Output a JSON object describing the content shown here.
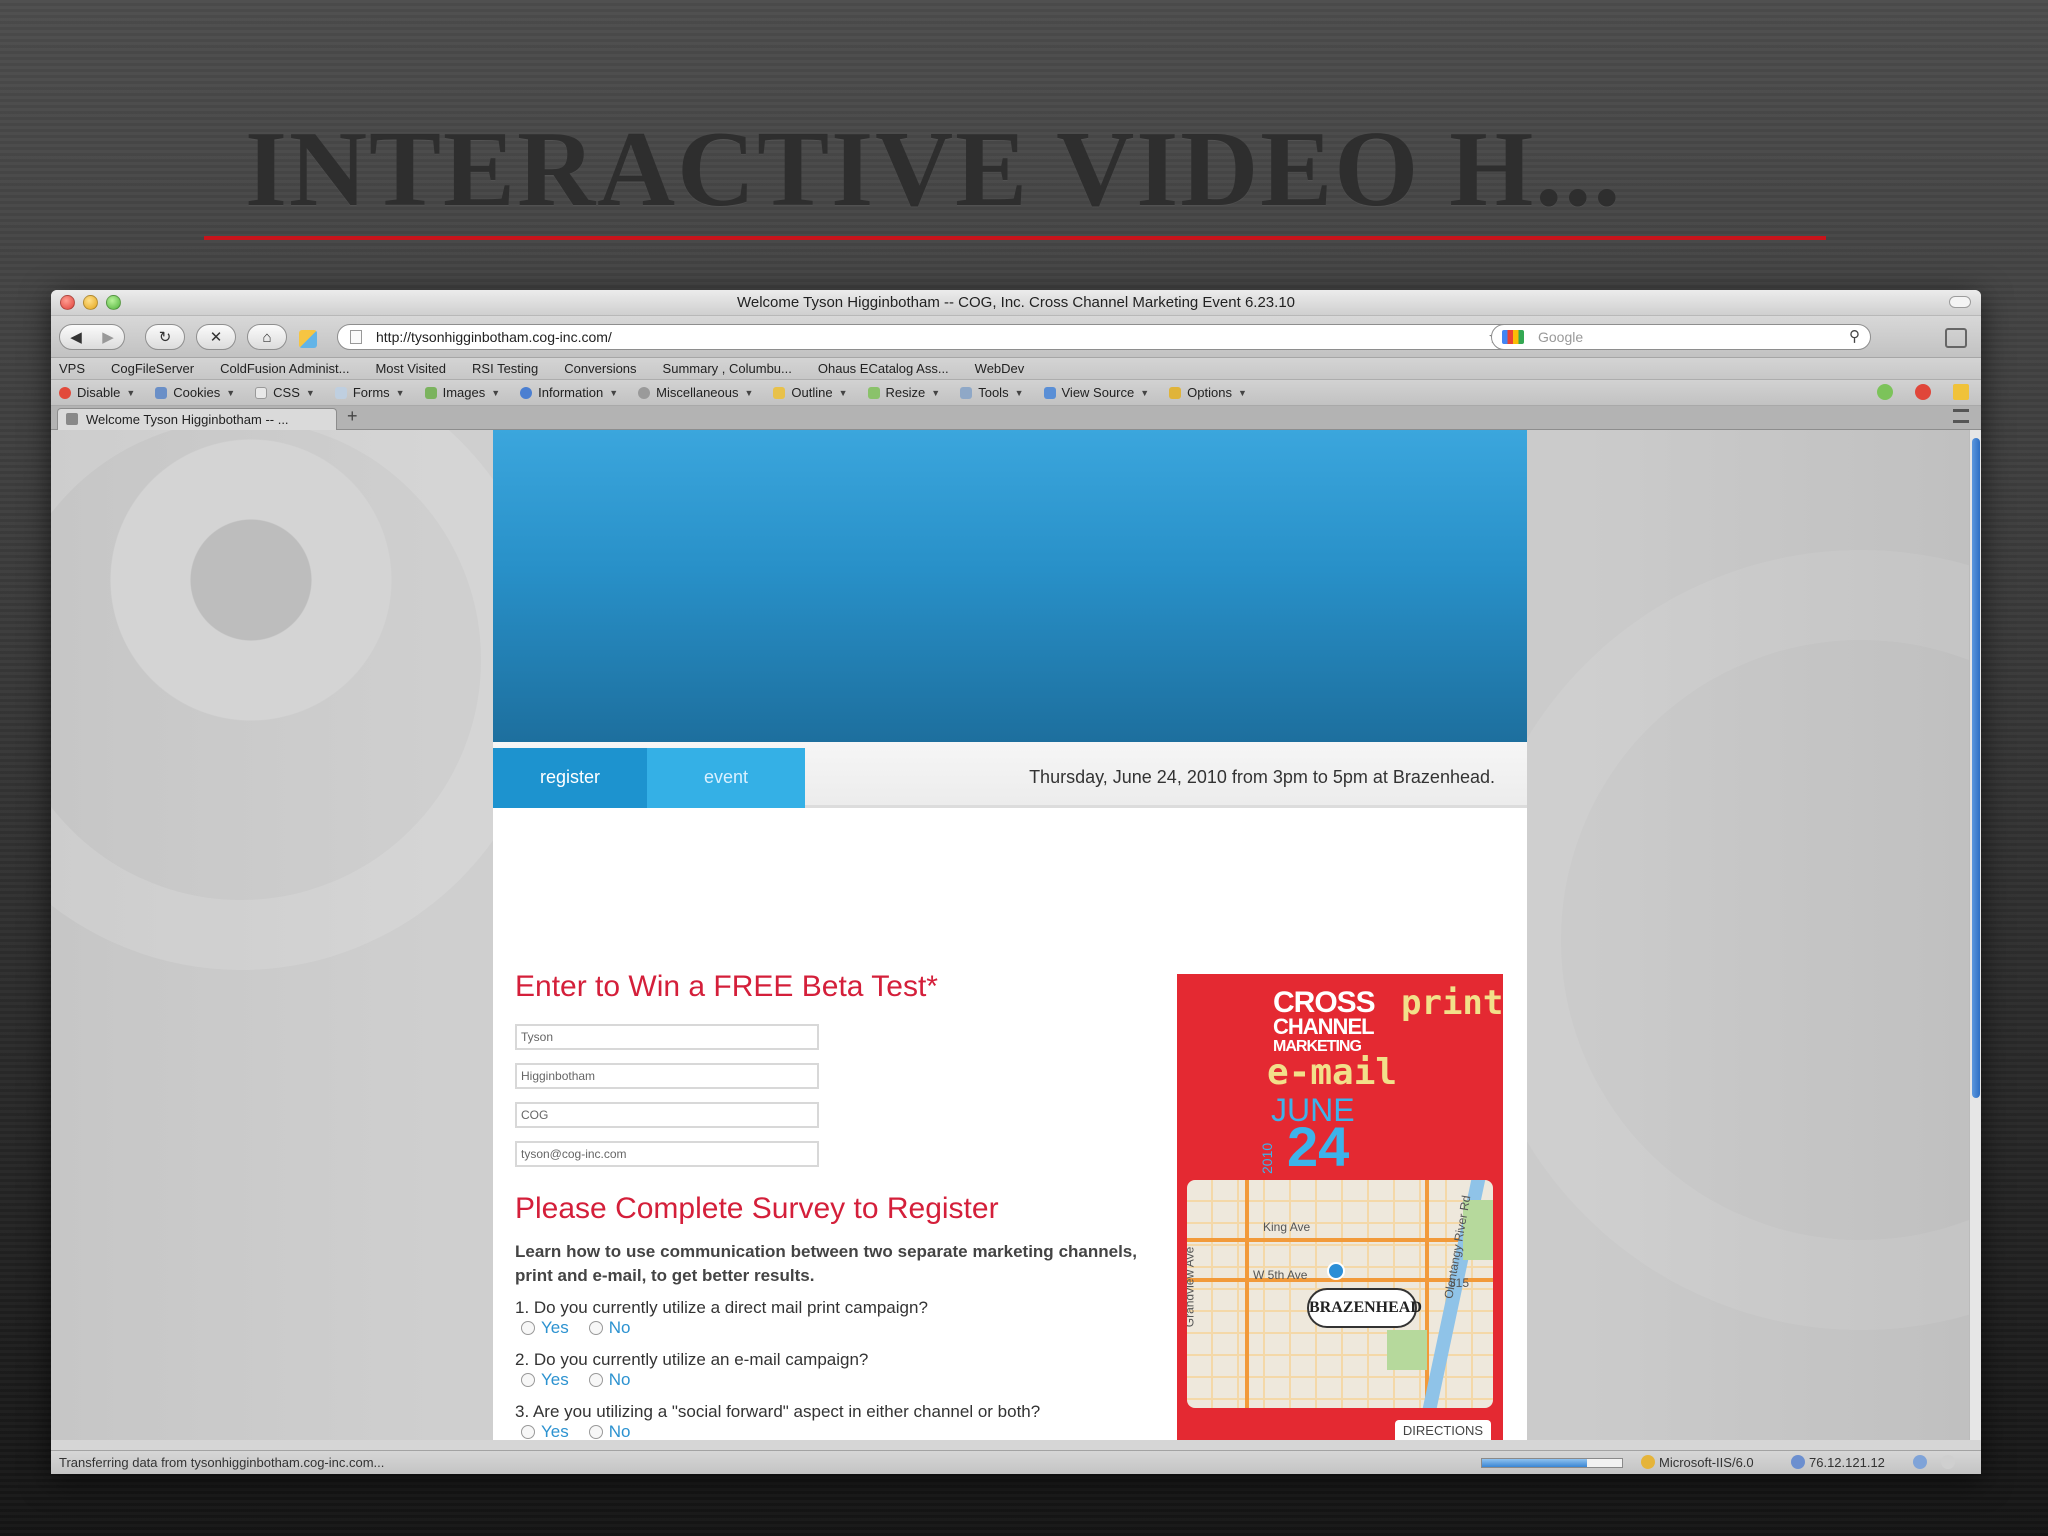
{
  "slide": {
    "title": "INTERACTIVE VIDEO H...",
    "accent_color": "#c8141b"
  },
  "browser": {
    "window_title": "Welcome Tyson Higginbotham -- COG, Inc. Cross Channel Marketing Event 6.23.10",
    "url": "http://tysonhigginbotham.cog-inc.com/",
    "search_placeholder": "Google",
    "bookmarks": [
      "VPS",
      "CogFileServer",
      "ColdFusion Administ...",
      "Most Visited",
      "RSI Testing",
      "Conversions",
      "Summary , Columbu...",
      "Ohaus ECatalog Ass...",
      "WebDev"
    ],
    "devtools": [
      "Disable",
      "Cookies",
      "CSS",
      "Forms",
      "Images",
      "Information",
      "Miscellaneous",
      "Outline",
      "Resize",
      "Tools",
      "View Source",
      "Options"
    ],
    "tab_title": "Welcome Tyson Higginbotham -- ...",
    "new_tab_symbol": "+",
    "status_text": "Transferring data from tysonhigginbotham.cog-inc.com...",
    "server": "Microsoft-IIS/6.0",
    "ip": "76.12.121.12",
    "load_progress": 0.75
  },
  "page": {
    "nav_register": "register",
    "nav_event": "event",
    "event_date": "Thursday, June 24, 2010 from 3pm to 5pm at Brazenhead.",
    "form_heading": "Enter to Win a FREE Beta Test*",
    "inputs": {
      "first_name": "Tyson",
      "last_name": "Higginbotham",
      "company": "COG",
      "email": "tyson@cog-inc.com"
    },
    "survey_heading": "Please Complete Survey to Register",
    "survey_intro": "Learn how to use communication between two separate marketing channels, print and e-mail, to get better results.",
    "questions": [
      {
        "text": "1. Do you currently utilize a direct mail print campaign?",
        "yes": "Yes",
        "no": "No"
      },
      {
        "text": "2. Do you currently utilize an e-mail campaign?",
        "yes": "Yes",
        "no": "No"
      },
      {
        "text": "3. Are you utilizing a \"social forward\" aspect in either channel or both?",
        "yes": "Yes",
        "no": "No"
      }
    ],
    "promo": {
      "cross": "CROSS",
      "channel": "CHANNEL",
      "marketing": "MARKETING",
      "email": "e-mail",
      "june": "JUNE",
      "day": "24",
      "year": "2010",
      "print": "print",
      "map_labels": {
        "king": "King Ave",
        "fifth": "W 5th Ave",
        "grandview": "Grandview Ave",
        "olentangy": "Olentangy River Rd",
        "route": "315"
      },
      "venue": "BRAZENHEAD",
      "directions": "DIRECTIONS"
    }
  }
}
